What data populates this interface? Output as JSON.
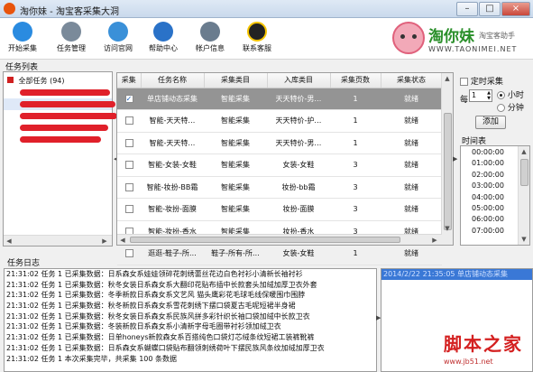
{
  "window": {
    "title": "淘你妹 - 淘宝客采集大洞",
    "min": "–",
    "max": "□",
    "close": "×"
  },
  "toolbar": [
    {
      "label": "开始采集",
      "icon": "play-icon",
      "color": "#2a8be0"
    },
    {
      "label": "任务管理",
      "icon": "gear-icon",
      "color": "#7a8a9a"
    },
    {
      "label": "访问官网",
      "icon": "globe-icon",
      "color": "#3a90d8"
    },
    {
      "label": "帮助中心",
      "icon": "help-icon",
      "color": "#2a72c8"
    },
    {
      "label": "帐户信息",
      "icon": "user-icon",
      "color": "#6a7c8e"
    },
    {
      "label": "联系客服",
      "icon": "qq-icon",
      "color": "#222222"
    }
  ],
  "logo": {
    "brand": "淘你妹",
    "tagline": "淘宝客助手",
    "url": "WWW.TAONIMEI.NET"
  },
  "task_list": {
    "label": "任务列表",
    "root": "全部任务 (94)"
  },
  "grid": {
    "headers": [
      "采集",
      "任务名称",
      "采集类目",
      "入库类目",
      "采集页数",
      "采集状态"
    ],
    "rows": [
      {
        "checked": true,
        "name": "单店铺动态采集",
        "cat": "智能采集",
        "store": "天天特价-男…",
        "pages": "1",
        "status": "就绪"
      },
      {
        "checked": false,
        "name": "智能-天天特…",
        "cat": "智能采集",
        "store": "天天特价-护…",
        "pages": "1",
        "status": "就绪"
      },
      {
        "checked": false,
        "name": "智能-天天特…",
        "cat": "智能采集",
        "store": "天天特价-男…",
        "pages": "1",
        "status": "就绪"
      },
      {
        "checked": false,
        "name": "智能-女装-女鞋",
        "cat": "智能采集",
        "store": "女装-女鞋",
        "pages": "3",
        "status": "就绪"
      },
      {
        "checked": false,
        "name": "智能-妆扮-BB霜",
        "cat": "智能采集",
        "store": "妆扮-bb霜",
        "pages": "3",
        "status": "就绪"
      },
      {
        "checked": false,
        "name": "智能-妆扮-面膜",
        "cat": "智能采集",
        "store": "妆扮-面膜",
        "pages": "3",
        "status": "就绪"
      },
      {
        "checked": false,
        "name": "智能-妆扮-香水",
        "cat": "智能采集",
        "store": "妆扮-香水",
        "pages": "3",
        "status": "就绪"
      },
      {
        "checked": false,
        "name": "逛逛-鞋子-所…",
        "cat": "鞋子-所有-所…",
        "store": "女装-女鞋",
        "pages": "1",
        "status": "就绪"
      }
    ]
  },
  "timer": {
    "enable_label": "定时采集",
    "every_label": "每",
    "value": "1",
    "hour": "小时",
    "minute": "分钟",
    "add_label": "添加",
    "list_label": "时间表",
    "times": [
      "00:00:00",
      "01:00:00",
      "02:00:00",
      "03:00:00",
      "04:00:00",
      "05:00:00",
      "06:00:00",
      "07:00:00"
    ]
  },
  "log": {
    "label": "任务日志",
    "lines": [
      "21:31:02 任务 1 已采集数据：日系森女系娃娃领碎花刺绣蕾丝花边白色衬衫小清新长袖衬衫",
      "21:31:02 任务 1 已采集数据：秋冬女装日系森女系大翻印花贴布插中长款套头加绒加厚卫衣外套",
      "21:31:02 任务 1 已采集数据：冬季新款日系森女系文艺风 猫头鹰彩花毛球毛线保暖围巾围脖",
      "21:31:02 任务 1 已采集数据：秋冬新款日系森女系雪花刺绣下摆口袋夏古毛呢短裙半身裙",
      "21:31:02 任务 1 已采集数据：秋冬女装日系森女系民族风拼多彩针织长袖口袋加绒中长款卫衣",
      "21:31:02 任务 1 已采集数据：冬装新款日系森女系小清新字母毛圈带衬衫领加绒卫衣",
      "21:31:02 任务 1 已采集数据：日单honeys新款森女系百搭纯色口袋灯芯绒条纹短裙工装裤靴裤",
      "21:31:02 任务 1 已采集数据：日系森女系蝴蝶口袋贴布翻领刺绣荷叶下摆民族风条纹加绒加厚卫衣",
      "21:31:02 任务 1 本次采集完毕，共采集 100 条数据"
    ],
    "side_entry": "2014/2/22 21:35:05 单店铺动态采集"
  },
  "watermark": {
    "text": "脚本之家",
    "url": "www.jb51.net"
  },
  "colors": {
    "accent": "#e8540c",
    "selected_row": "#949494",
    "red_mask": "#e0202a",
    "side_entry_bg": "#3a78d6"
  }
}
